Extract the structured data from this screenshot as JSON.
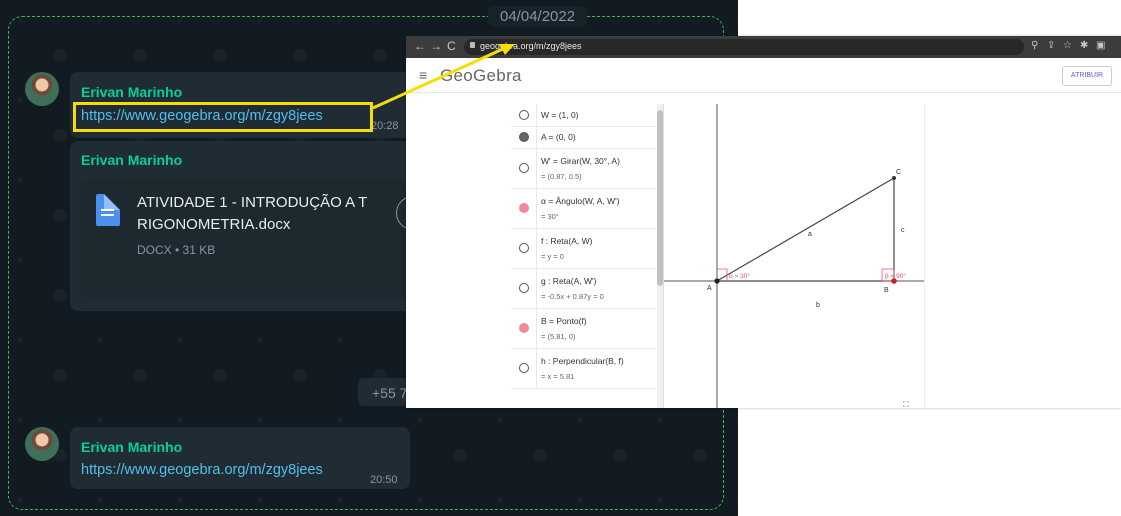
{
  "chat": {
    "date": "04/04/2022",
    "messages": [
      {
        "sender": "Erivan Marinho",
        "link": "https://www.geogebra.org/m/zgy8jees",
        "time": "20:28"
      },
      {
        "sender": "Erivan Marinho",
        "document": {
          "title_line1": "ATIVIDADE 1 - INTRODUÇÃO A T",
          "title_line2": "RIGONOMETRIA.docx",
          "meta": "DOCX • 31 KB"
        }
      },
      {
        "phone": "+55 7"
      },
      {
        "sender": "Erivan Marinho",
        "link": "https://www.geogebra.org/m/zgy8jees",
        "time": "20:50"
      }
    ],
    "colors": {
      "background": "#111b21",
      "bubble": "#202c33",
      "sender": "#06cf9c",
      "link": "#53bdeb",
      "highlight": "#f7dc0a",
      "frame": "#2fbd55"
    }
  },
  "browser": {
    "url": "geogebra.org/m/zgy8jees",
    "nav_icons": [
      "back-arrow-icon",
      "forward-arrow-icon",
      "reload-icon"
    ],
    "toolbar_icons": [
      "zoom-icon",
      "share-icon",
      "star-icon",
      "extensions-icon",
      "sidebar-icon"
    ],
    "app_name": "GeoGebra",
    "assign_button": "ATRIBUIR",
    "algebra": [
      {
        "def": "W = (1, 0)",
        "val": "",
        "marker": "empty"
      },
      {
        "def": "A = (0, 0)",
        "val": "",
        "marker": "gray"
      },
      {
        "def": "W' = Girar(W, 30°, A)",
        "val": "= (0.87, 0.5)",
        "marker": "empty"
      },
      {
        "def": "α = Ângulo(W, A, W')",
        "val": "= 30°",
        "marker": "pink"
      },
      {
        "def": "f : Reta(A, W)",
        "val": "= y = 0",
        "marker": "empty"
      },
      {
        "def": "g : Reta(A, W')",
        "val": "= -0.5x + 0.87y = 0",
        "marker": "empty"
      },
      {
        "def": "B = Ponto(f)",
        "val": "= (5.81, 0)",
        "marker": "pink"
      },
      {
        "def": "h : Perpendicular(B, f)",
        "val": "= x = 5.81",
        "marker": "empty"
      }
    ],
    "graph_labels": {
      "A": "A",
      "B": "B",
      "C": "C",
      "a": "a",
      "b": "b",
      "c": "c",
      "alpha": "α = 30°",
      "beta": "β = 90°"
    }
  }
}
